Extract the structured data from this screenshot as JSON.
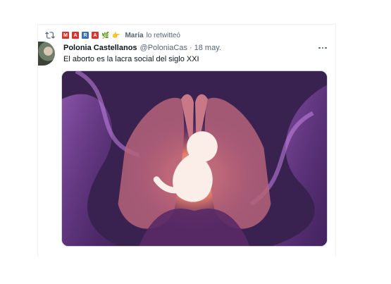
{
  "retweet": {
    "icon": "retweet-icon",
    "emoji": [
      "M",
      "A",
      "R",
      "A",
      "🌿",
      "👉"
    ],
    "name": "María",
    "verb": "lo retwitteó"
  },
  "tweet": {
    "display_name": "Polonia Castellanos",
    "handle": "@PoloniaCas",
    "separator": "·",
    "date": "18 may.",
    "text": "El aborto es la lacra social del siglo XXI",
    "more_icon": "more-options-icon",
    "media_description_icon": "tweet-image"
  },
  "colors": {
    "primary_text": "#0f1419",
    "secondary_text": "#536471",
    "border": "#eff3f4",
    "purple": "#8a3fb0"
  }
}
